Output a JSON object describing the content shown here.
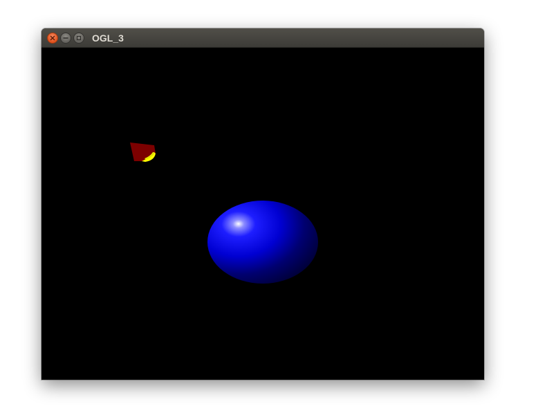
{
  "window": {
    "title": "OGL_3",
    "controls": {
      "close_icon": "close-icon",
      "minimize_icon": "minimize-icon",
      "maximize_icon": "maximize-icon"
    }
  },
  "scene": {
    "background": "#000000",
    "sphere": {
      "color": "#0000ff"
    },
    "cone": {
      "color": "#800000",
      "highlight": "#ffff00"
    }
  }
}
